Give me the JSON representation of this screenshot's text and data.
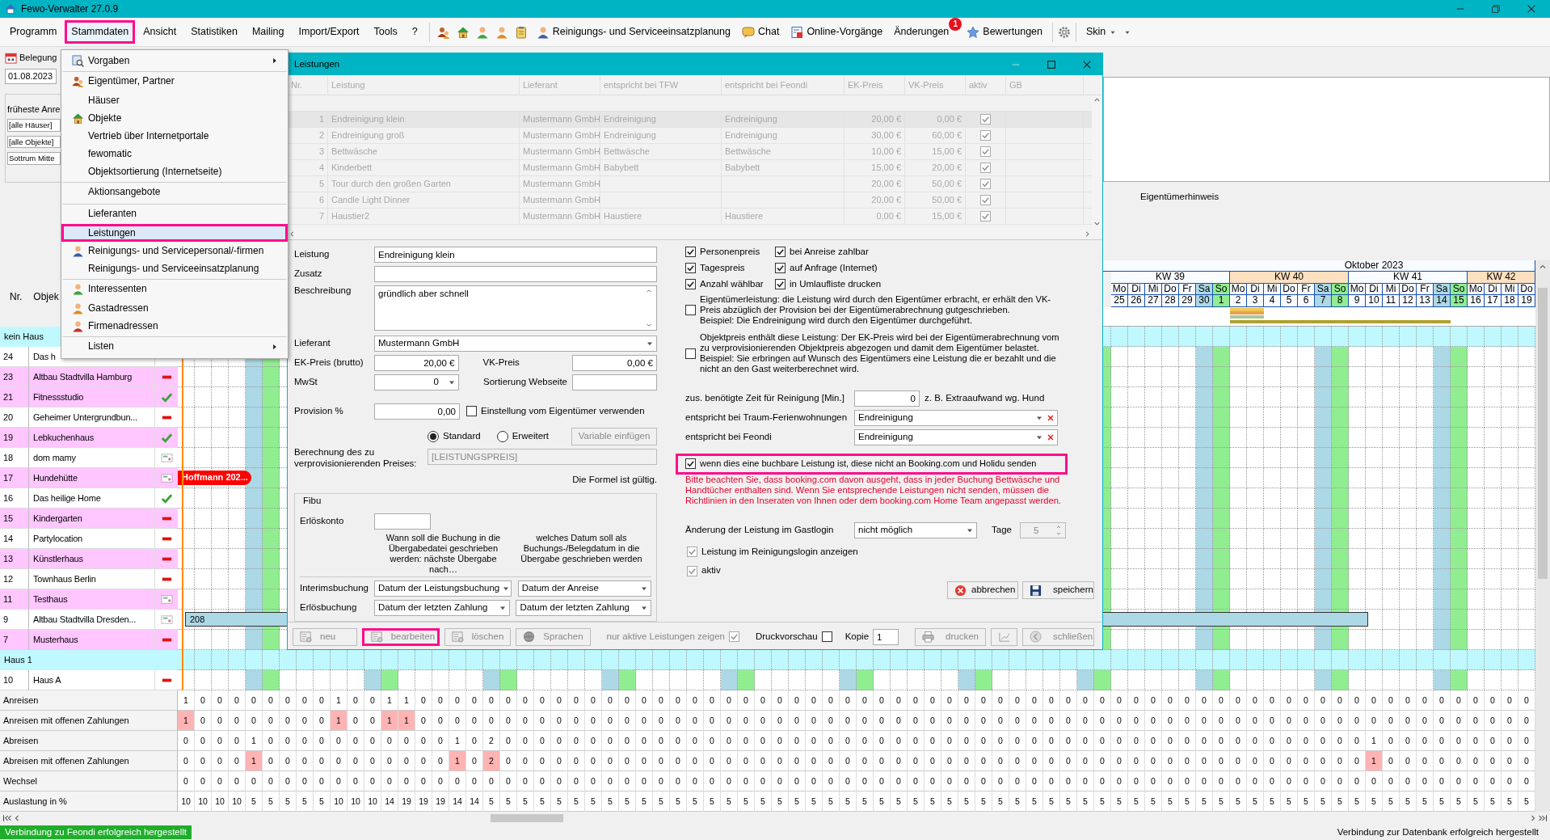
{
  "window": {
    "title": "Fewo-Verwalter 27.0.9"
  },
  "menu_bar": {
    "items": [
      {
        "label": "Programm",
        "selected": false
      },
      {
        "label": "Stammdaten",
        "selected": true
      },
      {
        "label": "Ansicht",
        "selected": false
      },
      {
        "label": "Statistiken",
        "selected": false
      },
      {
        "label": "Mailing",
        "selected": false
      },
      {
        "label": "Import/Export",
        "selected": false
      },
      {
        "label": "Tools",
        "selected": false
      },
      {
        "label": "?",
        "selected": false
      }
    ],
    "buttons": [
      {
        "label": "Reinigungs- und Serviceeinsatzplanung"
      },
      {
        "label": "Chat"
      },
      {
        "label": "Online-Vorgänge"
      },
      {
        "label": "Änderungen",
        "badge": "1"
      },
      {
        "label": "Bewertungen"
      }
    ],
    "skin": "Skin"
  },
  "left_panel": {
    "tab": "Belegung",
    "date": "01.08.2023",
    "earliest_label": "früheste Anre",
    "filters": [
      "[alle Häuser]",
      "[alle Objekte]",
      "Sottrum Mitte"
    ]
  },
  "owner_note": {
    "label": "Eigentümerhinweis"
  },
  "calendar": {
    "month": "Oktober 2023",
    "weeks": [
      {
        "label": "KW 39",
        "shaded": false
      },
      {
        "label": "KW 40",
        "shaded": true
      },
      {
        "label": "KW 41",
        "shaded": false
      },
      {
        "label": "KW 42",
        "shaded": true
      }
    ],
    "days": [
      {
        "weekday": "Mo",
        "date": "25",
        "kind": "weekday"
      },
      {
        "weekday": "Di",
        "date": "26",
        "kind": "weekday"
      },
      {
        "weekday": "Mi",
        "date": "27",
        "kind": "weekday"
      },
      {
        "weekday": "Do",
        "date": "28",
        "kind": "weekday"
      },
      {
        "weekday": "Fr",
        "date": "29",
        "kind": "weekday"
      },
      {
        "weekday": "Sa",
        "date": "30",
        "kind": "saturday"
      },
      {
        "weekday": "So",
        "date": "1",
        "kind": "sunday"
      },
      {
        "weekday": "Mo",
        "date": "2",
        "kind": "weekday"
      },
      {
        "weekday": "Di",
        "date": "3",
        "kind": "weekday"
      },
      {
        "weekday": "Mi",
        "date": "4",
        "kind": "weekday"
      },
      {
        "weekday": "Do",
        "date": "5",
        "kind": "weekday"
      },
      {
        "weekday": "Fr",
        "date": "6",
        "kind": "weekday"
      },
      {
        "weekday": "Sa",
        "date": "7",
        "kind": "saturday"
      },
      {
        "weekday": "So",
        "date": "8",
        "kind": "sunday"
      },
      {
        "weekday": "Mo",
        "date": "9",
        "kind": "weekday"
      },
      {
        "weekday": "Di",
        "date": "10",
        "kind": "weekday"
      },
      {
        "weekday": "Mi",
        "date": "11",
        "kind": "weekday"
      },
      {
        "weekday": "Do",
        "date": "12",
        "kind": "weekday"
      },
      {
        "weekday": "Fr",
        "date": "13",
        "kind": "weekday"
      },
      {
        "weekday": "Sa",
        "date": "14",
        "kind": "saturday"
      },
      {
        "weekday": "So",
        "date": "15",
        "kind": "sunday"
      },
      {
        "weekday": "Mo",
        "date": "16",
        "kind": "weekday"
      },
      {
        "weekday": "Di",
        "date": "17",
        "kind": "weekday"
      },
      {
        "weekday": "Mi",
        "date": "18",
        "kind": "weekday"
      },
      {
        "weekday": "Do",
        "date": "19",
        "kind": "weekday"
      }
    ]
  },
  "object_list": {
    "columns": [
      "Nr.",
      "Objek"
    ],
    "groups": [
      {
        "name": "kein Haus",
        "rows": [
          {
            "nr": "24",
            "name": "Das h",
            "highlighted": false
          },
          {
            "nr": "23",
            "name": "Altbau Stadtvilla Hamburg",
            "highlighted": true,
            "kind": "minus"
          },
          {
            "nr": "21",
            "name": "Fitnessstudio",
            "highlighted": true,
            "kind": "check"
          },
          {
            "nr": "20",
            "name": "Geheimer Untergrundbun...",
            "highlighted": false,
            "kind": "minus"
          },
          {
            "nr": "19",
            "name": "Lebkuchenhaus",
            "highlighted": true,
            "kind": "check"
          },
          {
            "nr": "18",
            "name": "dom mamy",
            "highlighted": false,
            "kind": "card"
          },
          {
            "nr": "17",
            "name": "Hundehütte",
            "highlighted": true,
            "kind": "card",
            "booking": {
              "label": "Hoffmann 202...",
              "color": "#ff0000"
            }
          },
          {
            "nr": "16",
            "name": "Das heilige Home",
            "highlighted": false,
            "kind": "check"
          },
          {
            "nr": "15",
            "name": "Kindergarten",
            "highlighted": true,
            "kind": "minus"
          },
          {
            "nr": "14",
            "name": "Partylocation",
            "highlighted": false,
            "kind": "minus"
          },
          {
            "nr": "13",
            "name": "Künstlerhaus",
            "highlighted": true,
            "kind": "minus"
          },
          {
            "nr": "12",
            "name": "Townhaus Berlin",
            "highlighted": false,
            "kind": "minus"
          },
          {
            "nr": "11",
            "name": "Testhaus",
            "highlighted": true,
            "kind": "card"
          },
          {
            "nr": "9",
            "name": "Altbau Stadtvilla Dresden...",
            "highlighted": false,
            "kind": "card",
            "booking": {
              "label": "208",
              "color": "#add8e6"
            }
          },
          {
            "nr": "7",
            "name": "Musterhaus",
            "highlighted": true,
            "kind": "minus"
          }
        ]
      },
      {
        "name": "Haus 1",
        "rows": [
          {
            "nr": "10",
            "name": "Haus A",
            "highlighted": false,
            "kind": "minus"
          }
        ]
      }
    ]
  },
  "stats": [
    {
      "label": "Anreisen",
      "values": [
        "1",
        "0",
        "0",
        "0",
        "0",
        "0",
        "0",
        "0",
        "0",
        "1",
        "0",
        "0",
        "1",
        "1",
        "0",
        "0",
        "0",
        "0",
        "0",
        "0",
        "0",
        "0",
        "0",
        "0",
        "0",
        "0",
        "0",
        "0",
        "0",
        "0",
        "0",
        "0",
        "0",
        "0",
        "0",
        "0",
        "0",
        "0",
        "0",
        "0",
        "0",
        "0",
        "0",
        "0",
        "0",
        "0",
        "0",
        "0",
        "0",
        "0",
        "0",
        "0",
        "0",
        "0",
        "0",
        "0",
        "0",
        "0",
        "0",
        "0",
        "0",
        "0",
        "0",
        "0",
        "0",
        "0",
        "0",
        "0",
        "0",
        "0",
        "0",
        "0",
        "0",
        "0",
        "0",
        "0",
        "0",
        "0",
        "0",
        "0"
      ]
    },
    {
      "label": "Anreisen mit offenen Zahlungen",
      "open_payments": true,
      "values": [
        "1",
        "0",
        "0",
        "0",
        "0",
        "0",
        "0",
        "0",
        "0",
        "1",
        "0",
        "0",
        "1",
        "1",
        "0",
        "0",
        "0",
        "0",
        "0",
        "0",
        "0",
        "0",
        "0",
        "0",
        "0",
        "0",
        "0",
        "0",
        "0",
        "0",
        "0",
        "0",
        "0",
        "0",
        "0",
        "0",
        "0",
        "0",
        "0",
        "0",
        "0",
        "0",
        "0",
        "0",
        "0",
        "0",
        "0",
        "0",
        "0",
        "0",
        "0",
        "0",
        "0",
        "0",
        "0",
        "0",
        "0",
        "0",
        "0",
        "0",
        "0",
        "0",
        "0",
        "0",
        "0",
        "0",
        "0",
        "0",
        "0",
        "0",
        "0",
        "0",
        "0",
        "0",
        "0",
        "0",
        "0",
        "0",
        "0",
        "0"
      ]
    },
    {
      "label": "Abreisen",
      "values": [
        "0",
        "0",
        "0",
        "0",
        "1",
        "0",
        "0",
        "0",
        "0",
        "0",
        "0",
        "0",
        "0",
        "0",
        "0",
        "0",
        "1",
        "0",
        "2",
        "0",
        "0",
        "0",
        "0",
        "0",
        "0",
        "0",
        "0",
        "0",
        "0",
        "0",
        "0",
        "0",
        "0",
        "0",
        "0",
        "0",
        "0",
        "0",
        "0",
        "0",
        "0",
        "0",
        "0",
        "0",
        "0",
        "0",
        "0",
        "0",
        "0",
        "0",
        "0",
        "0",
        "0",
        "0",
        "0",
        "0",
        "0",
        "0",
        "0",
        "0",
        "0",
        "0",
        "0",
        "0",
        "0",
        "0",
        "0",
        "0",
        "0",
        "0",
        "1",
        "0",
        "0",
        "0",
        "0",
        "0",
        "0",
        "0",
        "0",
        "0"
      ]
    },
    {
      "label": "Abreisen mit offenen Zahlungen",
      "open_payments": true,
      "values": [
        "0",
        "0",
        "0",
        "0",
        "1",
        "0",
        "0",
        "0",
        "0",
        "0",
        "0",
        "0",
        "0",
        "0",
        "0",
        "0",
        "1",
        "0",
        "2",
        "0",
        "0",
        "0",
        "0",
        "0",
        "0",
        "0",
        "0",
        "0",
        "0",
        "0",
        "0",
        "0",
        "0",
        "0",
        "0",
        "0",
        "0",
        "0",
        "0",
        "0",
        "0",
        "0",
        "0",
        "0",
        "0",
        "0",
        "0",
        "0",
        "0",
        "0",
        "0",
        "0",
        "0",
        "0",
        "0",
        "0",
        "0",
        "0",
        "0",
        "0",
        "0",
        "0",
        "0",
        "0",
        "0",
        "0",
        "0",
        "0",
        "0",
        "0",
        "1",
        "0",
        "0",
        "0",
        "0",
        "0",
        "0",
        "0",
        "0",
        "0"
      ]
    },
    {
      "label": "Wechsel",
      "values": [
        "0",
        "0",
        "0",
        "0",
        "0",
        "0",
        "0",
        "0",
        "0",
        "0",
        "0",
        "0",
        "0",
        "0",
        "0",
        "0",
        "0",
        "0",
        "0",
        "0",
        "0",
        "0",
        "0",
        "0",
        "0",
        "0",
        "0",
        "0",
        "0",
        "0",
        "0",
        "0",
        "0",
        "0",
        "0",
        "0",
        "0",
        "0",
        "0",
        "0",
        "0",
        "0",
        "0",
        "0",
        "0",
        "0",
        "0",
        "0",
        "0",
        "0",
        "0",
        "0",
        "0",
        "0",
        "0",
        "0",
        "0",
        "0",
        "0",
        "0",
        "0",
        "0",
        "0",
        "0",
        "0",
        "0",
        "0",
        "0",
        "0",
        "0",
        "0",
        "0",
        "0",
        "0",
        "0",
        "0",
        "0",
        "0",
        "0",
        "0"
      ]
    },
    {
      "label": "Auslastung in %",
      "values": [
        "10",
        "10",
        "10",
        "10",
        "5",
        "5",
        "5",
        "5",
        "5",
        "10",
        "10",
        "10",
        "14",
        "19",
        "19",
        "19",
        "14",
        "14",
        "5",
        "5",
        "5",
        "5",
        "5",
        "5",
        "5",
        "5",
        "5",
        "5",
        "5",
        "5",
        "5",
        "5",
        "5",
        "5",
        "5",
        "5",
        "5",
        "5",
        "5",
        "5",
        "5",
        "5",
        "5",
        "5",
        "5",
        "5",
        "5",
        "5",
        "5",
        "5",
        "5",
        "5",
        "5",
        "5",
        "5",
        "5",
        "5",
        "5",
        "5",
        "5",
        "5",
        "5",
        "5",
        "5",
        "5",
        "5",
        "5",
        "5",
        "5",
        "5",
        "5",
        "5",
        "5",
        "5",
        "5",
        "5",
        "5",
        "5",
        "5",
        "5"
      ]
    }
  ],
  "status_bar": {
    "left": "Verbindung zu Feondi erfolgreich hergestellt",
    "right": "Verbindung zur Datenbank erfolgreich hergestellt"
  },
  "dropdown_menu": {
    "items": [
      {
        "label": "Vorgaben",
        "submenu": true,
        "separator_before": false,
        "selected": false
      },
      {
        "label": "Eigentümer, Partner",
        "submenu": false,
        "separator_before": true,
        "selected": false
      },
      {
        "label": "Häuser",
        "submenu": false,
        "separator_before": false,
        "selected": false
      },
      {
        "label": "Objekte",
        "submenu": false,
        "separator_before": false,
        "selected": false
      },
      {
        "label": "Vertrieb über Internetportale",
        "submenu": false,
        "separator_before": false,
        "selected": false
      },
      {
        "label": "fewomatic",
        "submenu": false,
        "separator_before": false,
        "selected": false
      },
      {
        "label": "Objektsortierung (Internetseite)",
        "submenu": false,
        "separator_before": false,
        "selected": false
      },
      {
        "label": "Aktionsangebote",
        "submenu": false,
        "separator_before": true,
        "selected": false
      },
      {
        "label": "Lieferanten",
        "submenu": false,
        "separator_before": true,
        "selected": false
      },
      {
        "label": "Leistungen",
        "submenu": false,
        "separator_before": false,
        "selected": true
      },
      {
        "label": "Reinigungs- und Servicepersonal/-firmen",
        "submenu": false,
        "separator_before": false,
        "selected": false
      },
      {
        "label": "Reinigungs- und Serviceeinsatzplanung",
        "submenu": false,
        "separator_before": false,
        "selected": false
      },
      {
        "label": "Interessenten",
        "submenu": false,
        "separator_before": true,
        "selected": false
      },
      {
        "label": "Gastadressen",
        "submenu": false,
        "separator_before": false,
        "selected": false
      },
      {
        "label": "Firmenadressen",
        "submenu": false,
        "separator_before": false,
        "selected": false
      },
      {
        "label": "Listen",
        "submenu": true,
        "separator_before": true,
        "selected": false
      }
    ]
  },
  "dialog": {
    "title": "Leistungen",
    "table": {
      "columns": [
        "Nr.",
        "Leistung",
        "Lieferant",
        "entspricht bei TFW",
        "entspricht bei Feondi",
        "EK-Preis",
        "VK-Preis",
        "aktiv",
        "GB"
      ],
      "rows": [
        {
          "nr": "1",
          "service": "Endreinigung klein",
          "supplier": "Mustermann GmbH",
          "tfw": "Endreinigung",
          "feondi": "Endreinigung",
          "purchase_price": "20,00 €",
          "sale_price": "0,00 €",
          "active": true,
          "selected": true
        },
        {
          "nr": "2",
          "service": "Endreinigung groß",
          "supplier": "Mustermann GmbH",
          "tfw": "Endreinigung",
          "feondi": "Endreinigung",
          "purchase_price": "30,00 €",
          "sale_price": "60,00 €",
          "active": true,
          "selected": false
        },
        {
          "nr": "3",
          "service": "Bettwäsche",
          "supplier": "Mustermann GmbH",
          "tfw": "Bettwäsche",
          "feondi": "Bettwäsche",
          "purchase_price": "10,00 €",
          "sale_price": "15,00 €",
          "active": true,
          "selected": false
        },
        {
          "nr": "4",
          "service": "Kinderbett",
          "supplier": "Mustermann GmbH",
          "tfw": "Babybett",
          "feondi": "Babybett",
          "purchase_price": "15,00 €",
          "sale_price": "20,00 €",
          "active": true,
          "selected": false
        },
        {
          "nr": "5",
          "service": "Tour durch den großen Garten",
          "supplier": "Mustermann GmbH",
          "purchase_price": "20,00 €",
          "sale_price": "50,00 €",
          "active": true,
          "selected": false
        },
        {
          "nr": "6",
          "service": "Candle Light Dinner",
          "supplier": "Mustermann GmbH",
          "purchase_price": "20,00 €",
          "sale_price": "50,00 €",
          "active": true,
          "selected": false
        },
        {
          "nr": "7",
          "service": "Haustier2",
          "supplier": "Mustermann GmbH",
          "tfw": "Haustiere",
          "feondi": "Haustiere",
          "purchase_price": "0,00 €",
          "sale_price": "15,00 €",
          "active": true,
          "selected": false
        }
      ]
    },
    "form": {
      "service": {
        "label": "Leistung",
        "value": "Endreinigung klein"
      },
      "addition": {
        "label": "Zusatz"
      },
      "description": {
        "label": "Beschreibung",
        "value": "gründlich aber schnell"
      },
      "supplier": {
        "label": "Lieferant",
        "value": "Mustermann GmbH"
      },
      "purchase_price": {
        "label": "EK-Preis (brutto)",
        "value": "20,00 €"
      },
      "sale_price": {
        "label": "VK-Preis",
        "value": "0,00 €"
      },
      "vat": {
        "label": "MwSt",
        "value": "0"
      },
      "web_sort": {
        "label": "Sortierung Webseite"
      },
      "commission": {
        "label": "Provision %",
        "value": "0,00"
      },
      "owner_setting": {
        "label": "Einstellung vom Eigentümer verwenden",
        "checked": false
      },
      "calculation": {
        "label": "Berechnung des zu verprovisionierenden Preises:",
        "modes": [
          {
            "label": "Standard",
            "selected": true
          },
          {
            "label": "Erweitert",
            "selected": false
          }
        ],
        "insert_button": "Variable einfügen",
        "formula": "[LEISTUNGSPREIS]",
        "validity": "Die Formel ist gültig."
      },
      "fibu": {
        "title": "Fibu",
        "account_label": "Erlöskonto",
        "headers": [
          "Wann soll die Buchung in die Übergabedatei geschrieben werden: nächste Übergabe nach…",
          "welches Datum soll als Buchungs-/Belegdatum in die Übergabe geschrieben werden"
        ],
        "rows": [
          {
            "label": "Interimsbuchung",
            "values": [
              "Datum der Leistungsbuchung",
              "Datum der Anreise"
            ]
          },
          {
            "label": "Erlösbuchung",
            "values": [
              "Datum der letzten Zahlung",
              "Datum der letzten Zahlung"
            ]
          }
        ]
      }
    },
    "options": {
      "flags": [
        {
          "label": "Personenpreis",
          "checked": true
        },
        {
          "label": "bei Anreise zahlbar",
          "checked": true
        },
        {
          "label": "Tagespreis",
          "checked": true
        },
        {
          "label": "auf Anfrage (Internet)",
          "checked": true
        },
        {
          "label": "Anzahl wählbar",
          "checked": true
        },
        {
          "label": "in Umlaufliste drucken",
          "checked": true
        }
      ],
      "notes": [
        {
          "text": "Eigentümerleistung: die Leistung wird durch den Eigentümer erbracht, er erhält den VK-Preis abzüglich der Provision bei der Eigentümerabrechnung gutgeschrieben.\nBeispiel: Die Endreinigung wird durch den Eigentümer durchgeführt.",
          "checked": false
        },
        {
          "text": "Objektpreis enthält diese Leistung: Der EK-Preis wird bei der Eigentümerabrechnung vom zu verprovisionierenden Objektpreis abgezogen und damit dem Eigentümer belastet. Beispiel: Sie erbringen auf Wunsch des Eigentümers eine Leistung die er bezahlt und die nicht an den Gast weiterberechnet wird.",
          "checked": false
        }
      ],
      "cleaning_time": {
        "label": "zus. benötigte Zeit für Reinigung [Min.]",
        "value": "0",
        "hint": "z. B. Extraaufwand wg. Hund"
      },
      "mappings": [
        {
          "label": "entspricht bei Traum-Ferienwohnungen",
          "value": "Endreinigung"
        },
        {
          "label": "entspricht bei Feondi",
          "value": "Endreinigung"
        }
      ],
      "booking_exclude": {
        "label": "wenn dies eine buchbare Leistung ist, diese nicht an Booking.com und Holidu senden",
        "checked": true,
        "highlighted": true
      },
      "warning": "Bitte beachten Sie, dass booking.com davon ausgeht, dass in jeder Buchung Bettwäsche und Handtücher enthalten sind. Wenn Sie entsprechende Leistungen nicht senden, müssen die Richtlinien in den Inseraten von Ihnen oder dem booking.com Home Team angepasst werden.",
      "guest_change": {
        "label": "Änderung der Leistung im Gastlogin",
        "value": "nicht möglich",
        "days_label": "Tage",
        "days": "5"
      },
      "cleaning_login": {
        "label": "Leistung im Reinigungslogin anzeigen",
        "checked": true
      },
      "active": {
        "label": "aktiv",
        "checked": true
      },
      "cancel_button": "abbrechen",
      "save_button": "speichern"
    },
    "footer": {
      "buttons": [
        {
          "label": "neu",
          "highlighted": false
        },
        {
          "label": "bearbeiten",
          "highlighted": true
        },
        {
          "label": "löschen",
          "highlighted": false
        },
        {
          "label": "Sprachen",
          "highlighted": false
        }
      ],
      "only_active": {
        "label": "nur aktive Leistungen zeigen",
        "checked": true
      },
      "preview": {
        "label": "Druckvorschau",
        "checked": false
      },
      "copies": {
        "label": "Kopie",
        "value": "1"
      },
      "print_button": "drucken",
      "close_button": "schließen"
    }
  }
}
